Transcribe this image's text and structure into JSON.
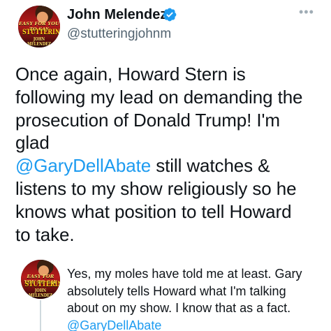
{
  "tweet": {
    "author": {
      "name": "John Melendez",
      "handle": "@stutteringjohnm",
      "verified": true,
      "avatar": {
        "line1": "EASY FOR YOU TO SAY",
        "line2": "STUTTERING",
        "line3": "JOHN MELENDEZ"
      }
    },
    "text_lines": [
      "Once again, Howard Stern is",
      "following my lead on demanding the",
      "prosecution of Donald Trump! I'm",
      "glad"
    ],
    "mention": "@GaryDellAbate",
    "text_after_mention": " still watches &",
    "text_lines_end": [
      "listens to my show religiously so he",
      "knows what position to tell Howard",
      "to take."
    ]
  },
  "reply": {
    "avatar": {
      "line1": "EASY FOR YOU TO SAY",
      "line2": "STUTTERING",
      "line3": "JOHN MELENDEZ"
    },
    "text_lines": [
      "Yes, my moles have told me at least. Gary",
      "absolutely tells Howard what I'm talking",
      "about on my show. I know that as a fact."
    ],
    "mention": "@GaryDellAbate"
  },
  "colors": {
    "link": "#1d9bf0",
    "text": "#0f1419",
    "secondary": "#536471",
    "verified": "#1d9bf0"
  },
  "icons": [
    "verified-badge-icon",
    "more-options-icon"
  ]
}
